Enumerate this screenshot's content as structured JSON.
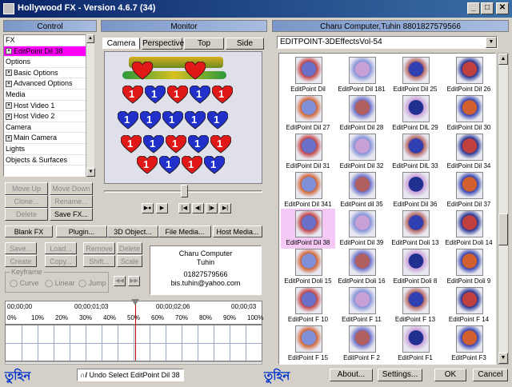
{
  "window": {
    "title": "Hollywood FX - Version 4.6.7 (34)",
    "min": "_",
    "max": "□",
    "close": "✕"
  },
  "control": {
    "header": "Control",
    "items": [
      {
        "label": "FX",
        "type": "sec"
      },
      {
        "label": "EditPoint Dil 38",
        "type": "sel"
      },
      {
        "label": "Options",
        "type": "sec"
      },
      {
        "label": "Basic Options",
        "type": "sub"
      },
      {
        "label": "Advanced Options",
        "type": "sub"
      },
      {
        "label": "Media",
        "type": "sec"
      },
      {
        "label": "Host Video 1",
        "type": "sub"
      },
      {
        "label": "Host Video 2",
        "type": "sub"
      },
      {
        "label": "Camera",
        "type": "sec"
      },
      {
        "label": "Main Camera",
        "type": "sub"
      },
      {
        "label": "Lights",
        "type": "sec"
      },
      {
        "label": "Objects & Surfaces",
        "type": "sec"
      }
    ],
    "move_up": "Move Up",
    "move_down": "Move Down",
    "clone": "Clone...",
    "rename": "Rename...",
    "delete": "Delete",
    "save_fx": "Save FX..."
  },
  "monitor": {
    "header": "Monitor",
    "tabs": [
      "Camera",
      "Perspective",
      "Top",
      "Side"
    ],
    "heart_number": "1",
    "heart_number_alt": "2"
  },
  "toolbar": {
    "blank_fx": "Blank FX",
    "plugin": "Plugin...",
    "object3d": "3D Object...",
    "file_media": "File Media...",
    "host_media": "Host Media..."
  },
  "keyframe": {
    "save": "Save...",
    "load": "Load...",
    "remove": "Remove",
    "delete": "Delete",
    "create": "Create",
    "copy": "Copy...",
    "shift": "Shift...",
    "scale": "Scale",
    "group_label": "Keyframe",
    "curve": "Curve",
    "linear": "Linear",
    "jump": "Jump"
  },
  "info": {
    "line1": "Charu Computer",
    "line2": "Tuhin",
    "line3": "01827579566",
    "line4": "bis.tuhin@yahoo.com"
  },
  "timeline": {
    "t_start": "00;00;00",
    "t_mid1": "00;00;01;03",
    "t_mid2": "00;00;02;06",
    "t_end": "00;00;03",
    "percents": [
      "0%",
      "10%",
      "20%",
      "30%",
      "40%",
      "50%",
      "60%",
      "70%",
      "80%",
      "90%",
      "100%"
    ]
  },
  "effects": {
    "header": "Charu Computer,Tuhin 8801827579566",
    "dropdown": "EDITPOINT-3DEffectsVol-54",
    "items": [
      "EditPoint Dil",
      "EditPoint Dil 181",
      "EditPoint Dil 25",
      "EditPoint Dil 26",
      "EditPoint Dil 27",
      "EditPoint Dil 28",
      "EditPoint DIL 29",
      "EditPoint Dil 30",
      "EditPoint Dil 31",
      "EditPoint Dil 32",
      "EditPoint DIL 33",
      "EditPoint Dil 34",
      "EditPoint Dil 341",
      "EditPoint dil 35",
      "EditPoint Dil 36",
      "EditPoint Dil 37",
      "EditPoint Dil 38",
      "EditPoint Dil 39",
      "EditPoint Doli 13",
      "EditPoint Doli 14",
      "EditPoint Doli 15",
      "EditPoint Doli 16",
      "EditPoint Doli 8",
      "EditPoint Doli 9",
      "EditPoint F 10",
      "EditPoint F 11",
      "EditPoint F 13",
      "EditPoint F 14",
      "EditPoint F 15",
      "EditPoint F 2",
      "EditPoint F1",
      "EditPoint F3"
    ]
  },
  "statusbar": {
    "bengali_left": "তুহিন",
    "bengali_right": "তুহিন",
    "undo_icon": "∩/",
    "undo": "Undo Select EditPoint Dil 38",
    "about": "About...",
    "settings": "Settings...",
    "ok": "OK",
    "cancel": "Cancel"
  },
  "colors": {
    "selection": "#ff00ff",
    "title_start": "#0a246a",
    "title_end": "#3a6ea5",
    "playhead": "#cc0000",
    "bengali": "#0033cc"
  }
}
